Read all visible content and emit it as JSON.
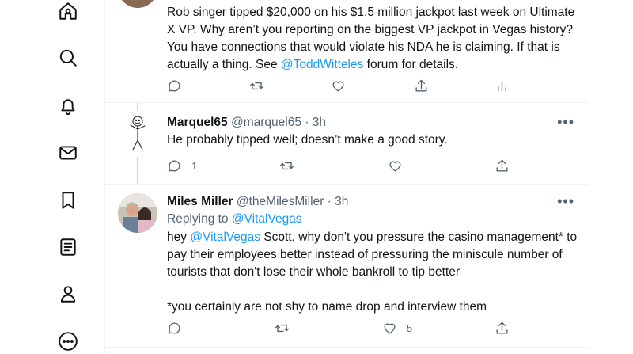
{
  "tweet1": {
    "text_a": "Rob singer tipped $20,000 on his $1.5 million jackpot last week on Ultimate X VP. Why aren’t you reporting on the biggest VP jackpot in Vegas history? You have connections that would violate his NDA he is claiming. If that is actually a thing. See ",
    "mention": "@ToddWitteles",
    "text_b": " forum for details."
  },
  "tweet2": {
    "name": "Marquel65",
    "handle": "@marquel65",
    "sep": "·",
    "time": "3h",
    "text": "He probably tipped well; doesn’t make a good story.",
    "reply_count": "1"
  },
  "tweet3": {
    "name": "Miles Miller",
    "handle": "@theMilesMiller",
    "sep": "·",
    "time": "3h",
    "replying_prefix": "Replying to ",
    "replying_to": "@VitalVegas",
    "text_lead": "hey ",
    "mention": "@VitalVegas",
    "text_body": " Scott, why don't you pressure the casino management* to pay their employees better instead of pressuring the miniscule number of tourists that don't lose their whole bankroll to tip better\n\n*you certainly are not shy to name drop and interview them",
    "like_count": "5"
  },
  "more_label": "•••",
  "sidebar_icons": [
    "home-icon",
    "explore-icon",
    "notifications-icon",
    "messages-icon",
    "bookmarks-icon",
    "lists-icon",
    "profile-icon",
    "more-icon"
  ],
  "accent_color": "#1d9bf0"
}
